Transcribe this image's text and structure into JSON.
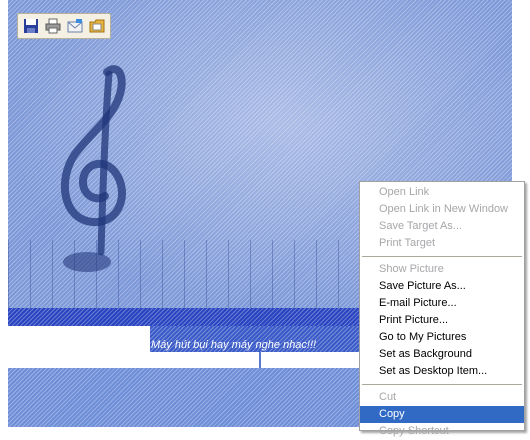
{
  "toolbar": {
    "icons": [
      "save-icon",
      "print-icon",
      "email-icon",
      "folder-icon"
    ]
  },
  "image_caption": "Máy hút bụi hay máy nghe nhạc!!!",
  "context_menu": {
    "group1": [
      {
        "label": "Open Link",
        "enabled": false
      },
      {
        "label": "Open Link in New Window",
        "enabled": false
      },
      {
        "label": "Save Target As...",
        "enabled": false
      },
      {
        "label": "Print Target",
        "enabled": false
      }
    ],
    "group2": [
      {
        "label": "Show Picture",
        "enabled": false
      },
      {
        "label": "Save Picture As...",
        "enabled": true
      },
      {
        "label": "E-mail Picture...",
        "enabled": true
      },
      {
        "label": "Print Picture...",
        "enabled": true
      },
      {
        "label": "Go to My Pictures",
        "enabled": true
      },
      {
        "label": "Set as Background",
        "enabled": true
      },
      {
        "label": "Set as Desktop Item...",
        "enabled": true
      }
    ],
    "group3": [
      {
        "label": "Cut",
        "enabled": false
      },
      {
        "label": "Copy",
        "enabled": true,
        "selected": true
      },
      {
        "label": "Copy Shortcut",
        "enabled": false
      }
    ]
  },
  "colors": {
    "selection": "#4a6fd0",
    "menu_highlight": "#316ac5",
    "menu_disabled_text": "#a7a6aa"
  }
}
